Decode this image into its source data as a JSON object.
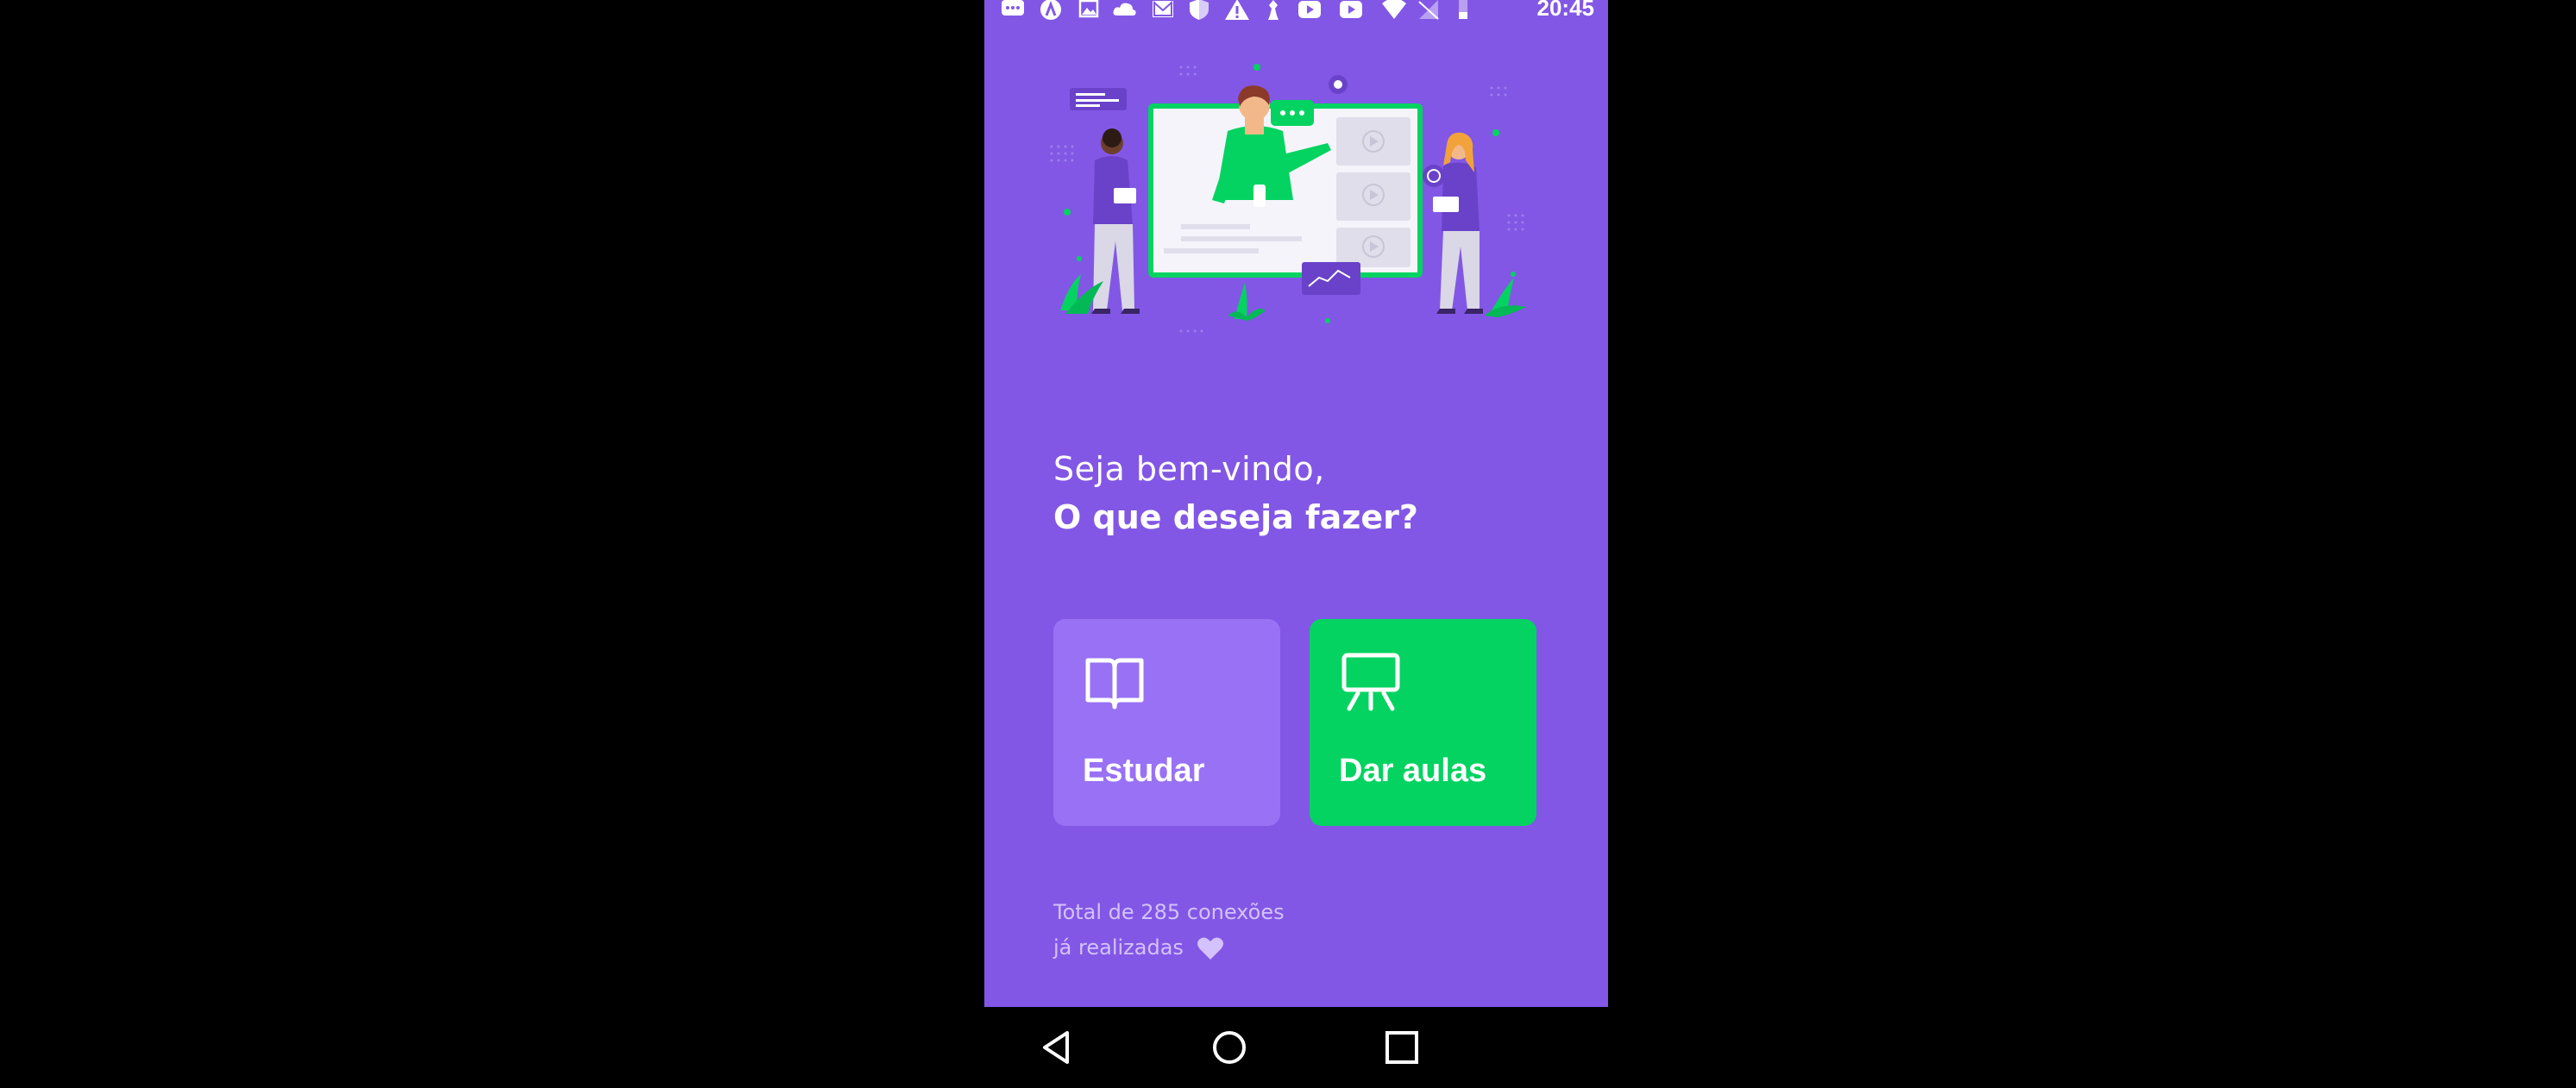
{
  "status_bar": {
    "time": "20:45",
    "icons": [
      "message-icon",
      "app-icon",
      "image-icon",
      "cloud-icon",
      "gmail-icon",
      "shield-icon",
      "warning-icon",
      "chess-icon",
      "youtube-icon",
      "youtube-icon",
      "wifi-icon",
      "no-signal-icon",
      "battery-icon"
    ]
  },
  "main": {
    "welcome": "Seja bem-vindo,",
    "question": "O que deseja fazer?"
  },
  "actions": {
    "study_label": "Estudar",
    "teach_label": "Dar aulas"
  },
  "footer": {
    "line1": "Total de 285 conexões",
    "line2": "já realizadas"
  },
  "nav": [
    "back-icon",
    "home-icon",
    "recents-icon"
  ],
  "colors": {
    "background": "#8257E5",
    "study_button": "#9871F5",
    "teach_button": "#04D361",
    "footer_text": "#D4C2FF"
  }
}
